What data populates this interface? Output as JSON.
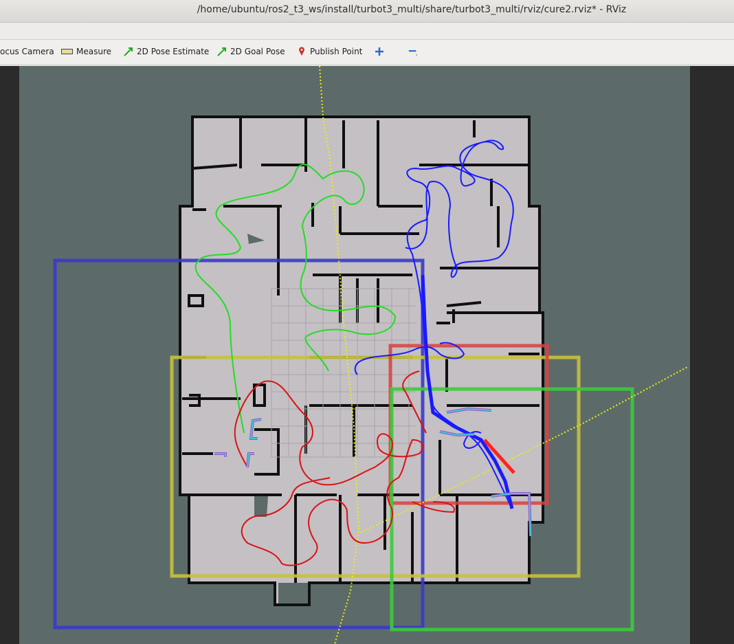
{
  "window": {
    "title": "/home/ubuntu/ros2_t3_ws/install/turbot3_multi/share/turbot3_multi/rviz/cure2.rviz* - RViz"
  },
  "toolbar": {
    "focus_camera": "ocus Camera",
    "measure": "Measure",
    "pose_estimate": "2D Pose Estimate",
    "goal_pose": "2D Goal Pose",
    "publish_point": "Publish Point",
    "add_icon": "plus-icon",
    "remove_icon": "minus-icon"
  },
  "colors": {
    "background": "#5c6b69",
    "map_free": "#c4c0c4",
    "wall": "#101010",
    "blue_region": "#3a3acc",
    "yellow_region": "#c8c23a",
    "red_region": "#d94040",
    "green_region": "#3acc3a",
    "blue_path": "#1a1aff",
    "green_path": "#22dd22",
    "red_path": "#dd1111"
  }
}
